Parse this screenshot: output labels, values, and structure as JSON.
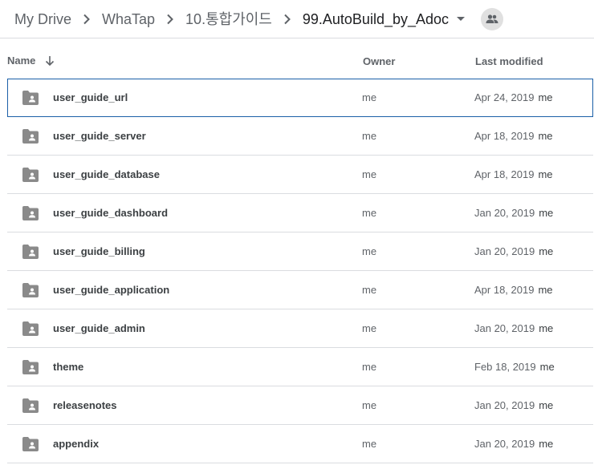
{
  "breadcrumb": {
    "items": [
      {
        "label": "My Drive"
      },
      {
        "label": "WhaTap"
      },
      {
        "label": "10.통합가이드"
      },
      {
        "label": "99.AutoBuild_by_Adoc"
      }
    ]
  },
  "columns": {
    "name": "Name",
    "owner": "Owner",
    "last_modified": "Last modified"
  },
  "rows": [
    {
      "name": "user_guide_url",
      "owner": "me",
      "date": "Apr 24, 2019",
      "by": "me",
      "selected": true
    },
    {
      "name": "user_guide_server",
      "owner": "me",
      "date": "Apr 18, 2019",
      "by": "me"
    },
    {
      "name": "user_guide_database",
      "owner": "me",
      "date": "Apr 18, 2019",
      "by": "me"
    },
    {
      "name": "user_guide_dashboard",
      "owner": "me",
      "date": "Jan 20, 2019",
      "by": "me"
    },
    {
      "name": "user_guide_billing",
      "owner": "me",
      "date": "Jan 20, 2019",
      "by": "me"
    },
    {
      "name": "user_guide_application",
      "owner": "me",
      "date": "Apr 18, 2019",
      "by": "me"
    },
    {
      "name": "user_guide_admin",
      "owner": "me",
      "date": "Jan 20, 2019",
      "by": "me"
    },
    {
      "name": "theme",
      "owner": "me",
      "date": "Feb 18, 2019",
      "by": "me"
    },
    {
      "name": "releasenotes",
      "owner": "me",
      "date": "Jan 20, 2019",
      "by": "me"
    },
    {
      "name": "appendix",
      "owner": "me",
      "date": "Jan 20, 2019",
      "by": "me"
    }
  ],
  "icons": {
    "folder": "shared-folder-icon",
    "separator": "chevron-right-icon",
    "caret": "caret-down-icon",
    "shared": "people-icon",
    "sort": "arrow-down-icon"
  },
  "colors": {
    "selected_border": "#1a5fa8",
    "folder_icon": "#8a8a8a",
    "divider": "#dadce0"
  }
}
